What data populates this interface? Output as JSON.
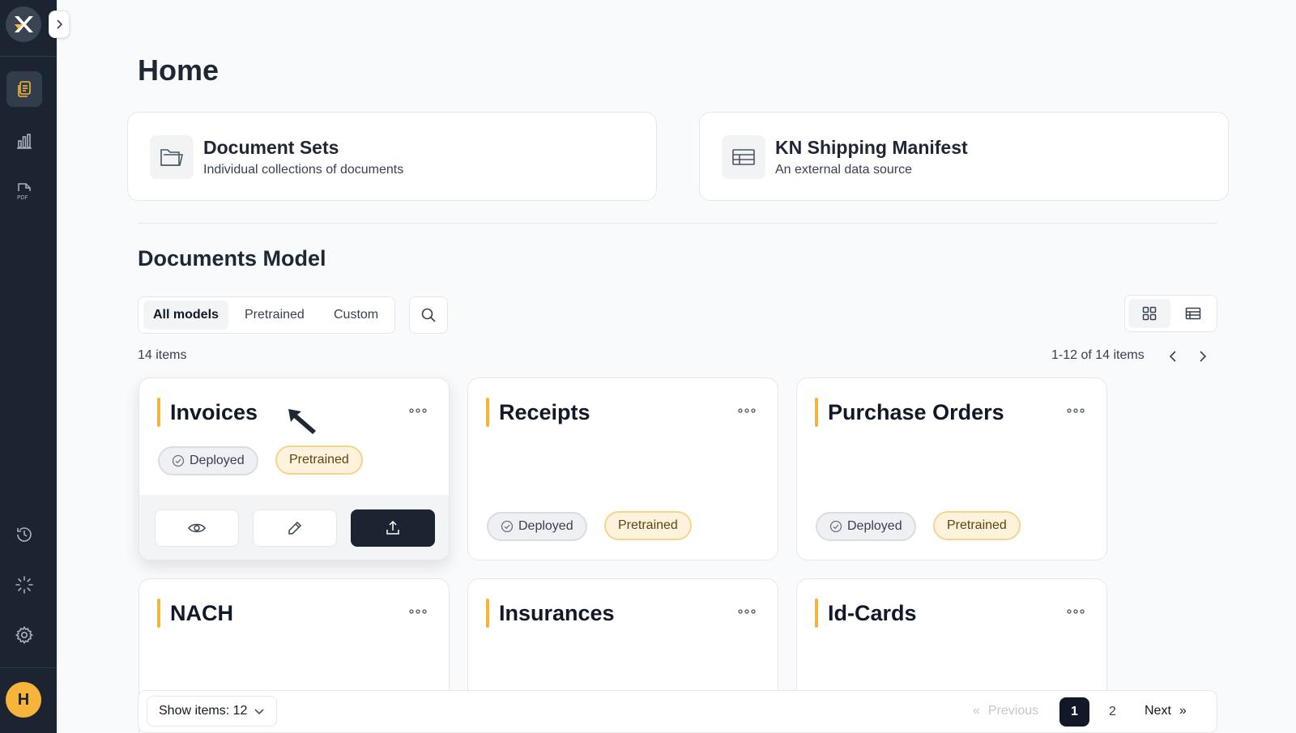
{
  "sidebar": {
    "logo_icon": "app-logo-icon",
    "nav": [
      {
        "icon": "documents-icon",
        "active": true
      },
      {
        "icon": "bar-chart-icon",
        "active": false
      },
      {
        "icon": "pdf-file-icon",
        "active": false
      }
    ],
    "bottom_nav": [
      {
        "icon": "history-icon"
      },
      {
        "icon": "loading-icon"
      },
      {
        "icon": "gear-icon"
      }
    ],
    "avatar_initial": "H"
  },
  "page": {
    "title": "Home"
  },
  "sources": [
    {
      "title": "Document Sets",
      "subtitle": "Individual collections of documents",
      "icon": "folder-icon"
    },
    {
      "title": "KN Shipping Manifest",
      "subtitle": "An external data source",
      "icon": "table-icon"
    }
  ],
  "models": {
    "title": "Documents Model",
    "filters": [
      "All models",
      "Pretrained",
      "Custom"
    ],
    "active_filter": "All models",
    "items_count": "14 items",
    "range": "1-12 of 14 items",
    "cards": [
      {
        "name": "Invoices",
        "status": "Deployed",
        "type": "Pretrained",
        "hovered": true
      },
      {
        "name": "Receipts",
        "status": "Deployed",
        "type": "Pretrained",
        "hovered": false
      },
      {
        "name": "Purchase Orders",
        "status": "Deployed",
        "type": "Pretrained",
        "hovered": false
      },
      {
        "name": "NACH",
        "status": "",
        "type": "",
        "hovered": false
      },
      {
        "name": "Insurances",
        "status": "",
        "type": "",
        "hovered": false
      },
      {
        "name": "Id-Cards",
        "status": "",
        "type": "",
        "hovered": false
      }
    ]
  },
  "pager": {
    "show_items": "Show items: 12",
    "previous": "Previous",
    "pages": [
      "1",
      "2"
    ],
    "current_page": "1",
    "next": "Next"
  },
  "colors": {
    "sidebar": "#1b2430",
    "accent": "#f6b53a",
    "primary_button": "#1b2430"
  }
}
